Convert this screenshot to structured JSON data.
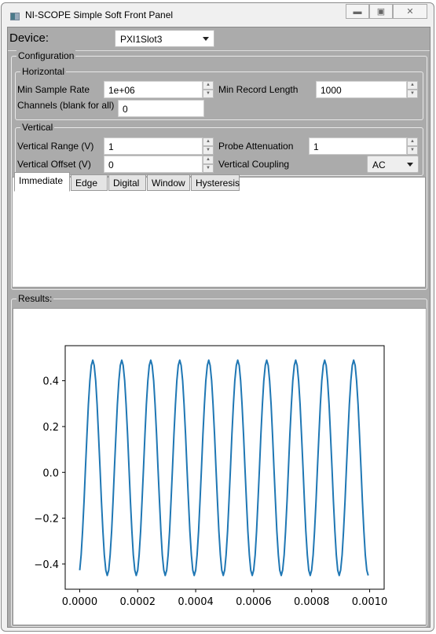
{
  "window": {
    "title": "NI-SCOPE Simple Soft Front Panel",
    "controls": [
      "minimize",
      "maximize",
      "close"
    ]
  },
  "device": {
    "label": "Device:",
    "value": "PXI1Slot3"
  },
  "configuration": {
    "label": "Configuration",
    "horizontal": {
      "label": "Horizontal",
      "min_sample_rate": {
        "label": "Min Sample Rate",
        "value": "1e+06"
      },
      "min_record_length": {
        "label": "Min Record Length",
        "value": "1000"
      },
      "channels": {
        "label": "Channels (blank for all)",
        "value": "0"
      }
    },
    "vertical": {
      "label": "Vertical",
      "vertical_range": {
        "label": "Vertical Range (V)",
        "value": "1"
      },
      "probe_attenuation": {
        "label": "Probe Attenuation",
        "value": "1"
      },
      "vertical_offset": {
        "label": "Vertical Offset (V)",
        "value": "0"
      },
      "vertical_coupling": {
        "label": "Vertical Coupling",
        "value": "AC"
      }
    },
    "trigger_tabs": [
      {
        "label": "Immediate",
        "active": true
      },
      {
        "label": "Edge"
      },
      {
        "label": "Digital"
      },
      {
        "label": "Window"
      },
      {
        "label": "Hysteresis"
      }
    ]
  },
  "results": {
    "label": "Results:"
  },
  "chart_data": {
    "type": "line",
    "color": "#1f77b4",
    "xlim": [
      -5e-05,
      0.00105
    ],
    "ylim": [
      -0.51,
      0.553
    ],
    "xticks": [
      "0.0000",
      "0.0002",
      "0.0004",
      "0.0006",
      "0.0008",
      "0.0010"
    ],
    "xtick_values": [
      0,
      0.0002,
      0.0004,
      0.0006,
      0.0008,
      0.001
    ],
    "yticks": [
      "0.4",
      "0.2",
      "0.0",
      "−0.2",
      "−0.4"
    ],
    "ytick_values": [
      0.4,
      0.2,
      0,
      -0.2,
      -0.4
    ],
    "grid": false,
    "x_start": 0,
    "x_step": 5e-06,
    "period_values": [
      -0.427,
      -0.36,
      -0.256,
      -0.125,
      0.02,
      0.165,
      0.296,
      0.4,
      0.467,
      0.49,
      0.467,
      0.4,
      0.296,
      0.165,
      0.02,
      -0.125,
      -0.256,
      -0.36,
      -0.427,
      -0.45
    ],
    "periods": 10
  }
}
